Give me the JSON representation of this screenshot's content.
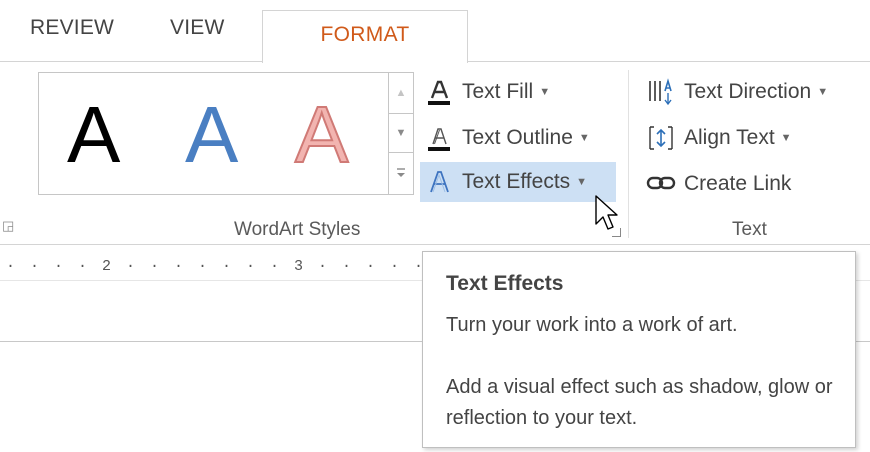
{
  "tabs": {
    "review": "REVIEW",
    "view": "VIEW",
    "format": "FORMAT"
  },
  "wordart": {
    "sample": "A",
    "group_label": "WordArt Styles"
  },
  "commands": {
    "text_fill": "Text Fill",
    "text_outline": "Text Outline",
    "text_effects": "Text Effects"
  },
  "text_group": {
    "text_direction": "Text Direction",
    "align_text": "Align Text",
    "create_link": "Create Link",
    "group_label": "Text"
  },
  "ruler": {
    "marks": "· · · · 2 · · · · · · · 3 · · · · ·"
  },
  "tooltip": {
    "title": "Text Effects",
    "line1": "Turn your work into a work of art.",
    "description": "Add a visual effect such as shadow, glow or reflection to your text."
  },
  "colors": {
    "accent_tab": "#d05a1a",
    "highlight": "#cde0f4"
  }
}
